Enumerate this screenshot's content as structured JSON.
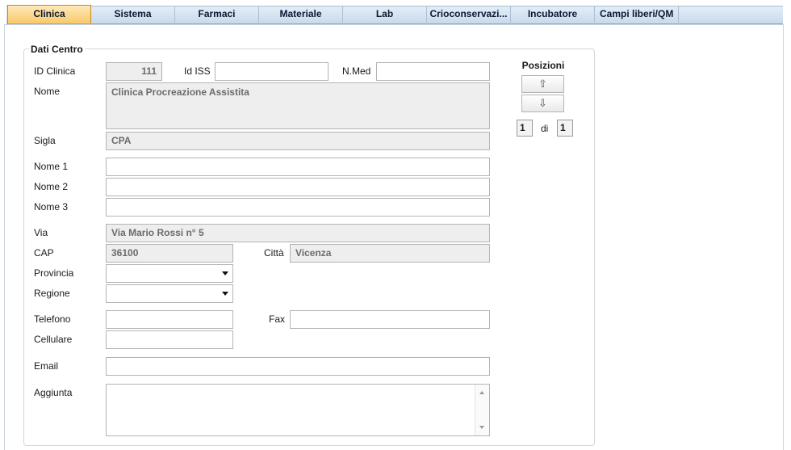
{
  "tabs": [
    {
      "label": "Clinica",
      "active": true
    },
    {
      "label": "Sistema",
      "active": false
    },
    {
      "label": "Farmaci",
      "active": false
    },
    {
      "label": "Materiale",
      "active": false
    },
    {
      "label": "Lab",
      "active": false
    },
    {
      "label": "Crioconservazi...",
      "active": false
    },
    {
      "label": "Incubatore",
      "active": false
    },
    {
      "label": "Campi liberi/QM",
      "active": false
    }
  ],
  "group_title": "Dati Centro",
  "fields": {
    "id_clinica": {
      "label": "ID Clinica",
      "value": "111"
    },
    "id_iss": {
      "label": "Id ISS",
      "value": ""
    },
    "n_med": {
      "label": "N.Med",
      "value": ""
    },
    "nome": {
      "label": "Nome",
      "value": "Clinica Procreazione Assistita"
    },
    "sigla": {
      "label": "Sigla",
      "value": "CPA"
    },
    "nome1": {
      "label": "Nome 1",
      "value": ""
    },
    "nome2": {
      "label": "Nome 2",
      "value": ""
    },
    "nome3": {
      "label": "Nome 3",
      "value": ""
    },
    "via": {
      "label": "Via",
      "value": "Via Mario Rossi n° 5"
    },
    "cap": {
      "label": "CAP",
      "value": "36100"
    },
    "citta": {
      "label": "Città",
      "value": "Vicenza"
    },
    "provincia": {
      "label": "Provincia",
      "value": ""
    },
    "regione": {
      "label": "Regione",
      "value": ""
    },
    "telefono": {
      "label": "Telefono",
      "value": ""
    },
    "fax": {
      "label": "Fax",
      "value": ""
    },
    "cellulare": {
      "label": "Cellulare",
      "value": ""
    },
    "email": {
      "label": "Email",
      "value": ""
    },
    "aggiunta": {
      "label": "Aggiunta",
      "value": ""
    }
  },
  "posizioni": {
    "title": "Posizioni",
    "up_icon": "⇧",
    "down_icon": "⇩",
    "current": "1",
    "of_label": "di",
    "total": "1"
  }
}
